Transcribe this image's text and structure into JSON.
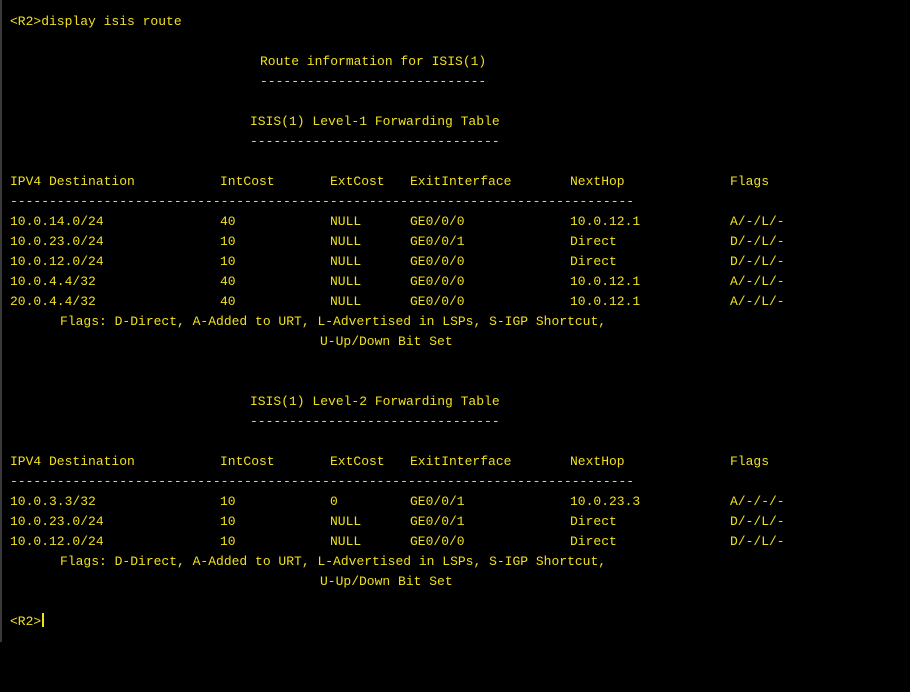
{
  "terminal": {
    "prompt": "<R2>",
    "command": "<R2>display isis route",
    "route_title": "Route information for ISIS(1)",
    "route_title_underline": "-----------------------------",
    "level1": {
      "title": "ISIS(1) Level-1 Forwarding Table",
      "underline": "--------------------------------",
      "headers": {
        "dest": "IPV4 Destination",
        "intcost": "IntCost",
        "extcost": "ExtCost",
        "exitif": "ExitInterface",
        "nexthop": "NextHop",
        "flags": "Flags"
      },
      "separator": "--------------------------------------------------------------------------------",
      "rows": [
        {
          "dest": "10.0.14.0/24",
          "intcost": "40",
          "extcost": "NULL",
          "exitif": "GE0/0/0",
          "nexthop": "10.0.12.1",
          "flags": "A/-/L/-"
        },
        {
          "dest": "10.0.23.0/24",
          "intcost": "10",
          "extcost": "NULL",
          "exitif": "GE0/0/1",
          "nexthop": "Direct",
          "flags": "D/-/L/-"
        },
        {
          "dest": "10.0.12.0/24",
          "intcost": "10",
          "extcost": "NULL",
          "exitif": "GE0/0/0",
          "nexthop": "Direct",
          "flags": "D/-/L/-"
        },
        {
          "dest": "10.0.4.4/32",
          "intcost": "40",
          "extcost": "NULL",
          "exitif": "GE0/0/0",
          "nexthop": "10.0.12.1",
          "flags": "A/-/L/-"
        },
        {
          "dest": "20.0.4.4/32",
          "intcost": "40",
          "extcost": "NULL",
          "exitif": "GE0/0/0",
          "nexthop": "10.0.12.1",
          "flags": "A/-/L/-"
        }
      ],
      "flags_note_1": "Flags: D-Direct, A-Added to URT, L-Advertised in LSPs, S-IGP Shortcut,",
      "flags_note_2": "U-Up/Down Bit Set"
    },
    "level2": {
      "title": "ISIS(1) Level-2 Forwarding Table",
      "underline": "--------------------------------",
      "headers": {
        "dest": "IPV4 Destination",
        "intcost": "IntCost",
        "extcost": "ExtCost",
        "exitif": "ExitInterface",
        "nexthop": "NextHop",
        "flags": "Flags"
      },
      "separator": "--------------------------------------------------------------------------------",
      "rows": [
        {
          "dest": "10.0.3.3/32",
          "intcost": "10",
          "extcost": "0",
          "exitif": "GE0/0/1",
          "nexthop": "10.0.23.3",
          "flags": "A/-/-/-"
        },
        {
          "dest": "10.0.23.0/24",
          "intcost": "10",
          "extcost": "NULL",
          "exitif": "GE0/0/1",
          "nexthop": "Direct",
          "flags": "D/-/L/-"
        },
        {
          "dest": "10.0.12.0/24",
          "intcost": "10",
          "extcost": "NULL",
          "exitif": "GE0/0/0",
          "nexthop": "Direct",
          "flags": "D/-/L/-"
        }
      ],
      "flags_note_1": "Flags: D-Direct, A-Added to URT, L-Advertised in LSPs, S-IGP Shortcut,",
      "flags_note_2": "U-Up/Down Bit Set"
    }
  }
}
